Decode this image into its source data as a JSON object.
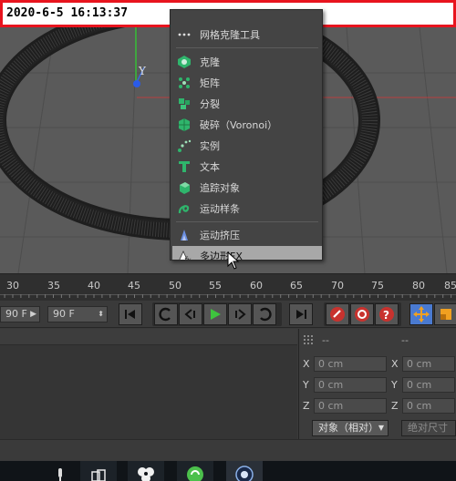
{
  "timestamp": "2020-6-5 16:13:37",
  "menu": {
    "partial_top_label": "网格克隆工具",
    "items": [
      {
        "label": "克隆",
        "icon": "cloner-icon"
      },
      {
        "label": "矩阵",
        "icon": "matrix-icon"
      },
      {
        "label": "分裂",
        "icon": "fracture-icon"
      },
      {
        "label": "破碎（Voronoi）",
        "icon": "voronoi-fracture-icon"
      },
      {
        "label": "实例",
        "icon": "instance-icon"
      },
      {
        "label": "文本",
        "icon": "text-icon"
      },
      {
        "label": "追踪对象",
        "icon": "tracer-icon"
      },
      {
        "label": "运动样条",
        "icon": "motion-spline-icon"
      }
    ],
    "items_b": [
      {
        "label": "运动挤压",
        "icon": "motion-extrude-icon"
      },
      {
        "label": "多边形FX",
        "icon": "polyfx-icon",
        "highlighted": true
      }
    ]
  },
  "timeline": {
    "ticks": [
      "30",
      "35",
      "40",
      "45",
      "50",
      "55",
      "60",
      "65",
      "70",
      "75",
      "80",
      "85"
    ]
  },
  "transport": {
    "start_field": "90 F",
    "end_field": "90 F"
  },
  "coords": {
    "header_left": "--",
    "header_right": "--",
    "rows": [
      {
        "axis": "X",
        "value": "0 cm",
        "axis2": "X",
        "value2": "0 cm"
      },
      {
        "axis": "Y",
        "value": "0 cm",
        "axis2": "Y",
        "value2": "0 cm"
      },
      {
        "axis": "Z",
        "value": "0 cm",
        "axis2": "Z",
        "value2": "0 cm"
      }
    ],
    "mode_label": "对象（相对）",
    "size_label": "绝对尺寸"
  },
  "colors": {
    "highlight_bg": "#a8a8a8",
    "stamp_border": "#e8141e",
    "play_green": "#3ec43e",
    "record_red": "#c8322e"
  }
}
